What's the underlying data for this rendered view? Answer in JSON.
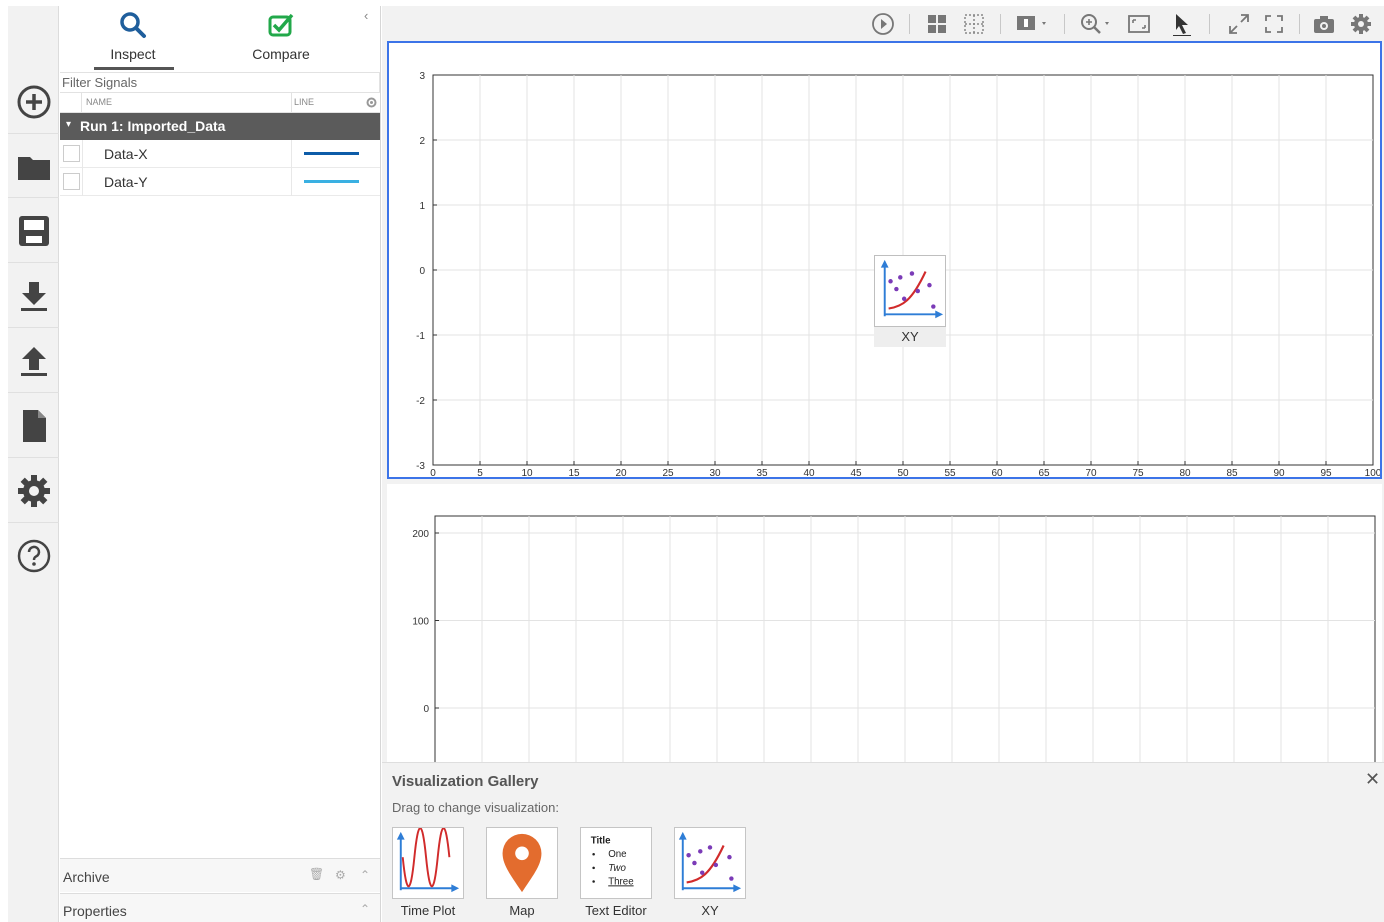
{
  "rail": {
    "items": [
      "new-session",
      "open",
      "save",
      "import",
      "export",
      "report",
      "settings",
      "help"
    ]
  },
  "panel": {
    "tabs": [
      {
        "label": "Inspect",
        "icon": "magnifier-icon",
        "active": true
      },
      {
        "label": "Compare",
        "icon": "checkbox-check-icon",
        "active": false
      }
    ],
    "filter_placeholder": "Filter Signals",
    "columns": {
      "name": "NAME",
      "line": "LINE"
    },
    "run": {
      "label": "Run 1: Imported_Data"
    },
    "signals": [
      {
        "name": "Data-X",
        "line_color": "#0d5ca8"
      },
      {
        "name": "Data-Y",
        "line_color": "#3ab0e2"
      }
    ],
    "archive_label": "Archive",
    "properties_label": "Properties"
  },
  "plot1": {
    "y_ticks": [
      "3",
      "2",
      "1",
      "0",
      "-1",
      "-2",
      "-3"
    ],
    "x_ticks": [
      "0",
      "5",
      "10",
      "15",
      "20",
      "25",
      "30",
      "35",
      "40",
      "45",
      "50",
      "55",
      "60",
      "65",
      "70",
      "75",
      "80",
      "85",
      "90",
      "95",
      "100"
    ],
    "ylim": [
      -3,
      3
    ],
    "xlim": [
      0,
      100
    ],
    "drag_label": "XY"
  },
  "plot2": {
    "y_ticks": [
      "200",
      "100",
      "0"
    ],
    "x_ticks_count": 20
  },
  "gallery": {
    "title": "Visualization Gallery",
    "hint": "Drag to change visualization:",
    "items": [
      {
        "label": "Time Plot",
        "icon": "time-plot-icon"
      },
      {
        "label": "Map",
        "icon": "map-pin-icon"
      },
      {
        "label": "Text Editor",
        "icon": "text-editor-icon"
      },
      {
        "label": "XY",
        "icon": "xy-plot-icon"
      }
    ],
    "text_editor_thumb": {
      "title": "Title",
      "bullets": [
        "One",
        "Two",
        "Three"
      ]
    }
  },
  "colors": {
    "accent_blue": "#3c74e8",
    "run_bg": "#5b5b5b",
    "compare_green": "#22a84a",
    "map_orange": "#e36c2e"
  }
}
